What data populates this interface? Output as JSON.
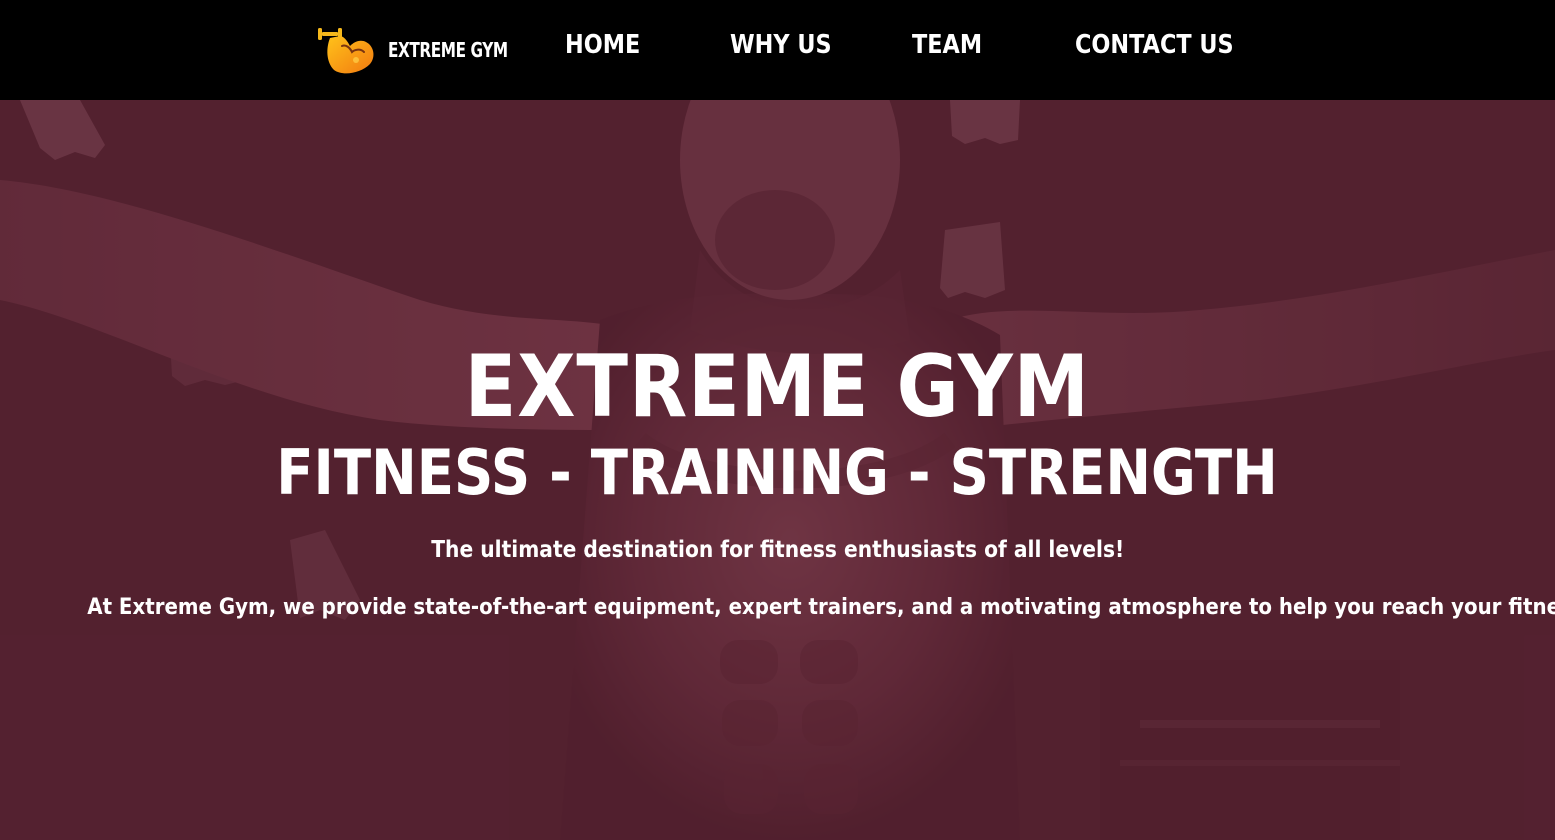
{
  "nav": {
    "brand": {
      "logo_icon": "flexed-bicep-dumbbell-icon",
      "name": "EXTREME GYM"
    },
    "links": [
      {
        "label": "HOME"
      },
      {
        "label": "WHY US"
      },
      {
        "label": "TEAM"
      },
      {
        "label": "CONTACT US"
      }
    ]
  },
  "hero": {
    "title": "EXTREME GYM",
    "subtitle": "FITNESS - TRAINING - STRENGTH",
    "tagline": "The ultimate destination for fitness enthusiasts of all levels!",
    "description": "At Extreme Gym, we provide state-of-the-art equipment, expert trainers, and a motivating atmosphere to help you reach your fitness goals."
  },
  "colors": {
    "navbar_bg": "#000000",
    "hero_overlay": "#5a2836",
    "logo_orange": "#f59a1b",
    "text": "#ffffff"
  }
}
